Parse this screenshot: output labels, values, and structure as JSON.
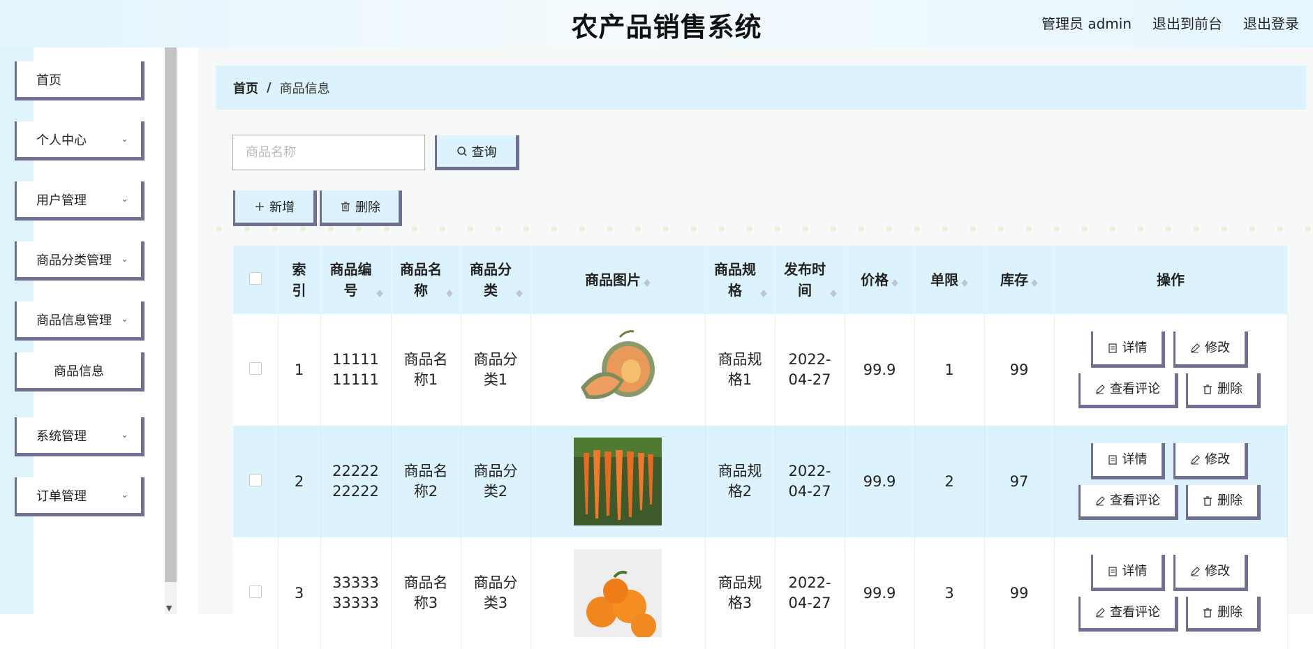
{
  "header": {
    "title": "农产品销售系统",
    "admin_label": "管理员 admin",
    "front_label": "退出到前台",
    "logout_label": "退出登录"
  },
  "sidebar": {
    "items": [
      {
        "label": "首页"
      },
      {
        "label": "个人中心"
      },
      {
        "label": "用户管理"
      },
      {
        "label": "商品分类管理"
      },
      {
        "label": "商品信息管理"
      },
      {
        "label": "商品信息"
      },
      {
        "label": "系统管理"
      },
      {
        "label": "订单管理"
      }
    ]
  },
  "breadcrumb": {
    "home": "首页",
    "separator": "/",
    "current": "商品信息"
  },
  "search": {
    "placeholder": "商品名称",
    "query_label": "查询"
  },
  "toolbar": {
    "add_label": "新增",
    "delete_label": "删除"
  },
  "table": {
    "headers": {
      "index": "索引",
      "code": "商品编号",
      "name": "商品名称",
      "category": "商品分类",
      "image": "商品图片",
      "spec": "商品规格",
      "date": "发布时间",
      "price": "价格",
      "limit": "单限",
      "stock": "库存",
      "ops": "操作"
    },
    "ops_labels": {
      "detail": "详情",
      "edit": "修改",
      "reviews": "查看评论",
      "delete": "删除"
    },
    "rows": [
      {
        "index": "1",
        "code": "1111111111",
        "name": "商品名称1",
        "category": "商品分类1",
        "image": "melon",
        "spec": "商品规格1",
        "date": "2022-04-27",
        "price": "99.9",
        "limit": "1",
        "stock": "99"
      },
      {
        "index": "2",
        "code": "2222222222",
        "name": "商品名称2",
        "category": "商品分类2",
        "image": "carrots",
        "spec": "商品规格2",
        "date": "2022-04-27",
        "price": "99.9",
        "limit": "2",
        "stock": "97"
      },
      {
        "index": "3",
        "code": "3333333333",
        "name": "商品名称3",
        "category": "商品分类3",
        "image": "oranges",
        "spec": "商品规格3",
        "date": "2022-04-27",
        "price": "99.9",
        "limit": "3",
        "stock": "99"
      }
    ]
  },
  "colors": {
    "accent_bg": "#dcf3fd",
    "button_border": "#6e6f93"
  }
}
